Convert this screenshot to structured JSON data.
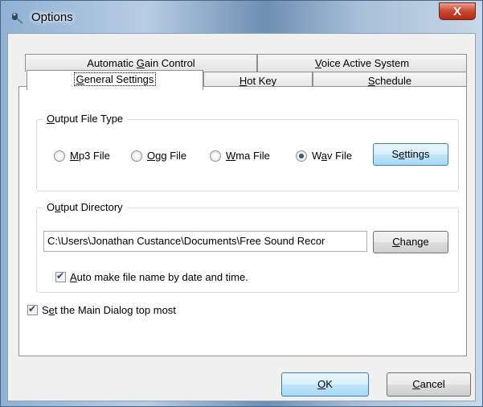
{
  "window": {
    "title": "Options",
    "close_label": "X"
  },
  "tabs": {
    "automatic_gain_control": {
      "pre": "Automatic ",
      "key": "G",
      "post": "ain Control"
    },
    "voice_active_system": {
      "pre": "",
      "key": "V",
      "post": "oice Active System"
    },
    "general_settings": {
      "pre": "",
      "key": "G",
      "post": "eneral Settings"
    },
    "hot_key": {
      "pre": "",
      "key": "H",
      "post": "ot Key"
    },
    "schedule": {
      "pre": "",
      "key": "S",
      "post": "chedule"
    }
  },
  "output_file_type": {
    "title": {
      "pre": "",
      "key": "O",
      "post": "utput File Type"
    },
    "options": [
      {
        "pre": "",
        "key": "M",
        "post": "p3 File",
        "selected": false
      },
      {
        "pre": "",
        "key": "O",
        "post": "gg File",
        "selected": false
      },
      {
        "pre": "",
        "key": "W",
        "post": "ma File",
        "selected": false
      },
      {
        "pre": "W",
        "key": "a",
        "post": "v File",
        "selected": true
      }
    ],
    "settings_button": {
      "pre": "S",
      "key": "e",
      "post": "ttings"
    }
  },
  "output_directory": {
    "title": {
      "pre": "O",
      "key": "u",
      "post": "tput Directory"
    },
    "path_value": "C:\\Users\\Jonathan Custance\\Documents\\Free Sound Recor",
    "change_button": {
      "pre": "",
      "key": "C",
      "post": "hange"
    },
    "auto_name": {
      "pre": "",
      "key": "A",
      "post": "uto make file name by date and time.",
      "checked": true
    }
  },
  "topmost": {
    "pre": "S",
    "key": "e",
    "post": "t the Main Dialog top most",
    "checked": true
  },
  "buttons": {
    "ok": {
      "pre": "",
      "key": "O",
      "post": "K"
    },
    "cancel": {
      "pre": "",
      "key": "C",
      "post": "ancel"
    }
  }
}
